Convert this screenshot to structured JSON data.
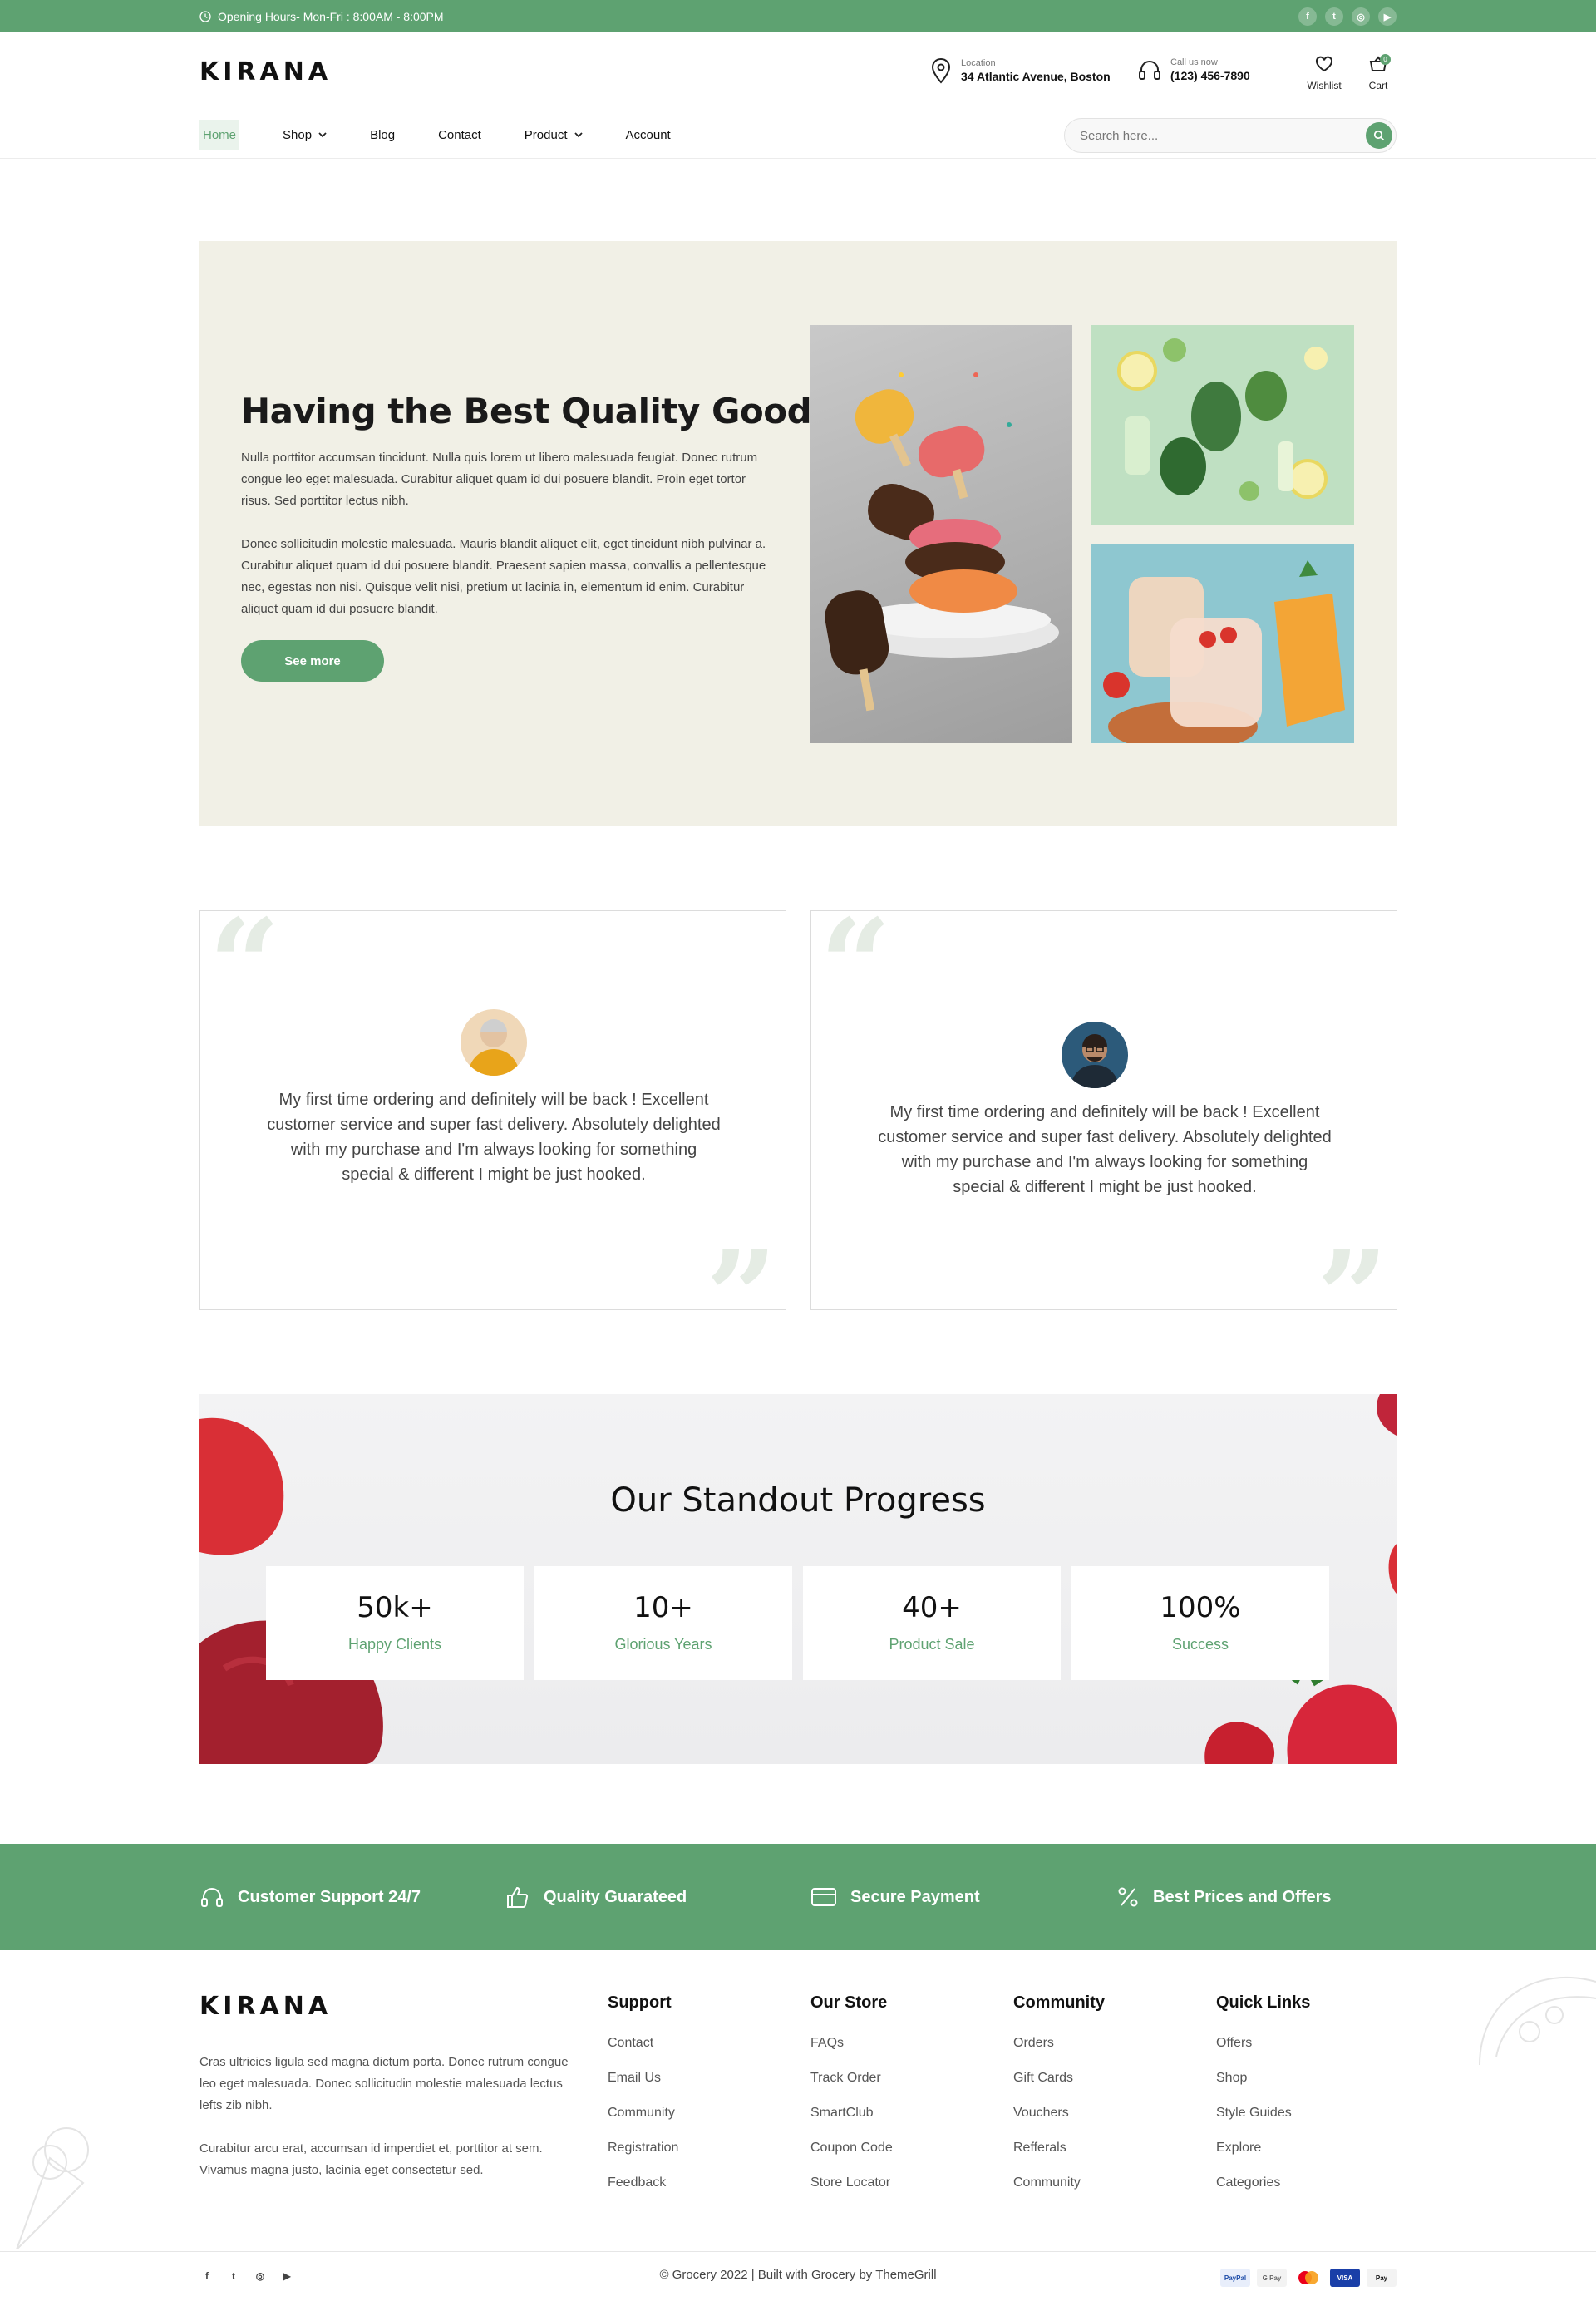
{
  "topbar": {
    "hours": "Opening Hours- Mon-Fri : 8:00AM - 8:00PM",
    "socials": [
      "facebook-icon",
      "twitter-icon",
      "instagram-icon",
      "youtube-icon"
    ]
  },
  "header": {
    "logo": "KIRANA",
    "location_label": "Location",
    "location_value": "34 Atlantic Avenue, Boston",
    "call_label": "Call us now",
    "call_value": "(123) 456-7890",
    "wishlist": "Wishlist",
    "cart": "Cart",
    "cart_count": "0"
  },
  "nav": {
    "items": [
      "Home",
      "Shop",
      "Blog",
      "Contact",
      "Product",
      "Account"
    ],
    "search_placeholder": "Search here..."
  },
  "hero": {
    "title": "Having the Best Quality Goods",
    "para1": "Nulla porttitor accumsan tincidunt. Nulla quis lorem ut libero malesuada feugiat. Donec rutrum congue leo eget malesuada. Curabitur aliquet quam id dui posuere blandit. Proin eget tortor risus. Sed porttitor lectus nibh.",
    "para2": "Donec sollicitudin molestie malesuada. Mauris blandit aliquet elit, eget tincidunt nibh pulvinar a. Curabitur aliquet quam id dui posuere blandit. Praesent sapien massa, convallis a pellentesque nec, egestas non nisi. Quisque velit nisi, pretium ut lacinia in, elementum id enim. Curabitur aliquet quam id dui posuere blandit.",
    "button": "See more"
  },
  "testimonials": [
    {
      "text": "My first time ordering and definitely will be back ! Excellent customer service and super fast delivery. Absolutely delighted with my purchase and I'm always looking for something special & different I might be just hooked."
    },
    {
      "text": "My first time ordering and definitely will be back ! Excellent customer service and super fast delivery. Absolutely delighted with my purchase and I'm always looking for something special & different I might be just hooked."
    }
  ],
  "progress": {
    "title": "Our Standout Progress",
    "stats": [
      {
        "value": "50k+",
        "label": "Happy Clients"
      },
      {
        "value": "10+",
        "label": "Glorious Years"
      },
      {
        "value": "40+",
        "label": "Product Sale"
      },
      {
        "value": "100%",
        "label": "Success"
      }
    ]
  },
  "features": [
    {
      "icon": "headphones-icon",
      "label": "Customer Support 24/7"
    },
    {
      "icon": "thumbs-up-icon",
      "label": "Quality Guarateed"
    },
    {
      "icon": "credit-card-icon",
      "label": "Secure Payment"
    },
    {
      "icon": "percent-icon",
      "label": "Best Prices and Offers"
    }
  ],
  "footer": {
    "logo": "KIRANA",
    "text1": "Cras ultricies ligula sed magna dictum porta. Donec rutrum congue leo eget malesuada. Donec sollicitudin molestie malesuada lectus lefts zib nibh.",
    "text2": "Curabitur arcu erat, accumsan id imperdiet et, porttitor at sem. Vivamus magna justo, lacinia eget consectetur sed.",
    "columns": [
      {
        "title": "Support",
        "links": [
          "Contact",
          "Email Us",
          "Community",
          "Registration",
          "Feedback"
        ]
      },
      {
        "title": "Our Store",
        "links": [
          "FAQs",
          "Track Order",
          "SmartClub",
          "Coupon Code",
          "Store Locator"
        ]
      },
      {
        "title": "Community",
        "links": [
          "Orders",
          "Gift Cards",
          "Vouchers",
          "Refferals",
          "Community"
        ]
      },
      {
        "title": "Quick Links",
        "links": [
          "Offers",
          "Shop",
          "Style Guides",
          "Explore",
          "Categories"
        ]
      }
    ],
    "copyright": "© Grocery 2022 | Built with Grocery by ThemeGrill",
    "payments": [
      "PayPal",
      "G Pay",
      "",
      "VISA",
      "Pay"
    ]
  },
  "colors": {
    "accent": "#5ea271",
    "hero_bg": "#f1f0e6"
  }
}
